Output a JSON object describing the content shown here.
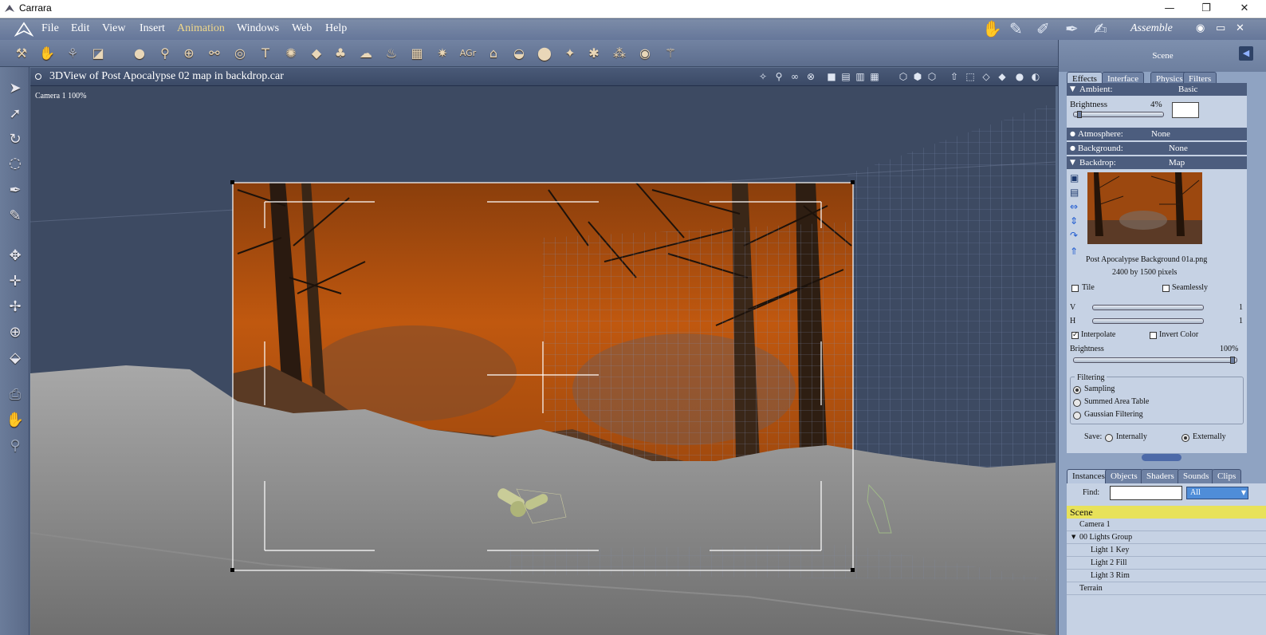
{
  "window": {
    "title": "Carrara",
    "minimize": "—",
    "restore": "❐",
    "close": "✕"
  },
  "menu": {
    "items": [
      "File",
      "Edit",
      "View",
      "Insert",
      "Animation",
      "Windows",
      "Web",
      "Help"
    ],
    "active": "Animation"
  },
  "rooms": {
    "label": "Assemble"
  },
  "viewport": {
    "title": "3DView of Post Apocalypse 02 map in backdrop.car",
    "camera_label": "Camera 1 100%"
  },
  "right_panel": {
    "title": "Scene",
    "tabs": [
      "Effects",
      "Interface",
      "Physics",
      "Filters"
    ],
    "ambient": {
      "label": "Ambient:",
      "mode": "Basic",
      "brightness_label": "Brightness",
      "brightness_value": "4%",
      "brightness_fraction": 0.04
    },
    "atmosphere": {
      "label": "Atmosphere:",
      "value": "None"
    },
    "background": {
      "label": "Background:",
      "value": "None"
    },
    "backdrop": {
      "label": "Backdrop:",
      "value": "Map",
      "file_name": "Post Apocalypse Background 01a.png",
      "dimensions": "2400 by 1500 pixels",
      "tile_label": "Tile",
      "seamlessly_label": "Seamlessly",
      "v_label": "V",
      "v_value": "1",
      "h_label": "H",
      "h_value": "1",
      "interpolate_label": "Interpolate",
      "invert_label": "Invert Color",
      "brightness_label": "Brightness",
      "brightness_value": "100%",
      "brightness_fraction": 1.0,
      "filtering_label": "Filtering",
      "filter_options": [
        "Sampling",
        "Summed Area Table",
        "Gaussian Filtering"
      ],
      "save_label": "Save:",
      "save_internally": "Internally",
      "save_externally": "Externally"
    },
    "bottom_tabs": [
      "Instances",
      "Objects",
      "Shaders",
      "Sounds",
      "Clips"
    ],
    "find_label": "Find:",
    "find_value": "",
    "filter_value": "All",
    "tree_header": "Scene",
    "tree": [
      "Camera 1",
      "00 Lights Group",
      "Light 1 Key",
      "Light 2 Fill",
      "Light 3 Rim",
      "Terrain"
    ]
  }
}
